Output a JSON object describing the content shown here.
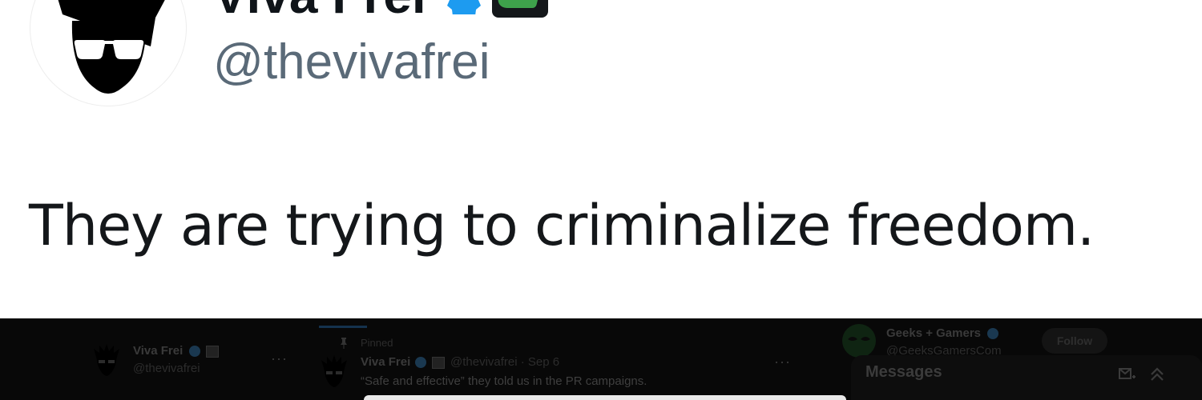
{
  "tweet": {
    "author_name": "Viva Frei",
    "handle": "@thevivafrei",
    "text": "They are trying to criminalize freedom."
  },
  "background": {
    "profile": {
      "name": "Viva Frei",
      "handle": "@thevivafrei",
      "more_label": "···"
    },
    "pinned_post": {
      "pinned_label": "Pinned",
      "author_name": "Viva Frei",
      "handle_date": "@thevivafrei · Sep 6",
      "text": "“Safe and effective” they told us in the PR campaigns.",
      "more_label": "···"
    },
    "suggestion": {
      "name": "Geeks + Gamers",
      "handle": "@GeeksGamersCom",
      "follow_label": "Follow"
    },
    "messages_title": "Messages"
  },
  "colors": {
    "verified": "#1d9bf0",
    "badge_green": "#3ea24b",
    "handle_gray": "#5a6a78",
    "overlay_dark": "#080808"
  },
  "icons": [
    "verified-badge-icon",
    "affiliate-badge-icon",
    "pin-icon",
    "more-icon",
    "new-message-icon",
    "collapse-icon"
  ]
}
